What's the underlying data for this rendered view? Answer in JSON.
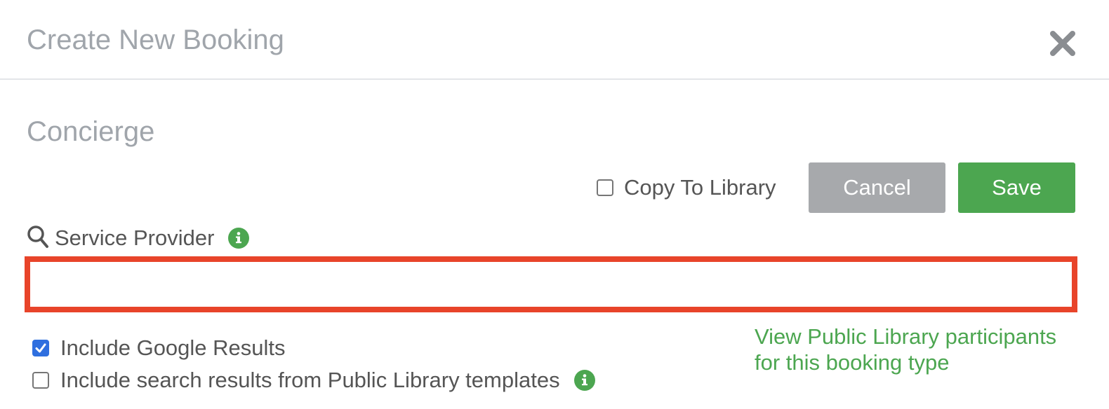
{
  "modal": {
    "title": "Create New Booking",
    "close_icon": "close-icon"
  },
  "section": {
    "title": "Concierge"
  },
  "actions": {
    "copy_to_library": {
      "label": "Copy To Library",
      "checked": false
    },
    "cancel_label": "Cancel",
    "save_label": "Save"
  },
  "service_provider": {
    "label": "Service Provider",
    "search_icon": "search-icon",
    "info_icon": "info-icon",
    "value": "",
    "placeholder": ""
  },
  "options": {
    "include_google": {
      "label": "Include Google Results",
      "checked": true
    },
    "include_public_library": {
      "label": "Include search results from Public Library templates",
      "checked": false
    }
  },
  "public_link": {
    "text": "View Public Library participants for this booking type"
  },
  "colors": {
    "accent_green": "#4ca650",
    "error_red": "#e8442a",
    "checkbox_blue": "#2f6fdf",
    "muted_gray": "#a7a9ac",
    "title_gray": "#a0a5ab"
  }
}
